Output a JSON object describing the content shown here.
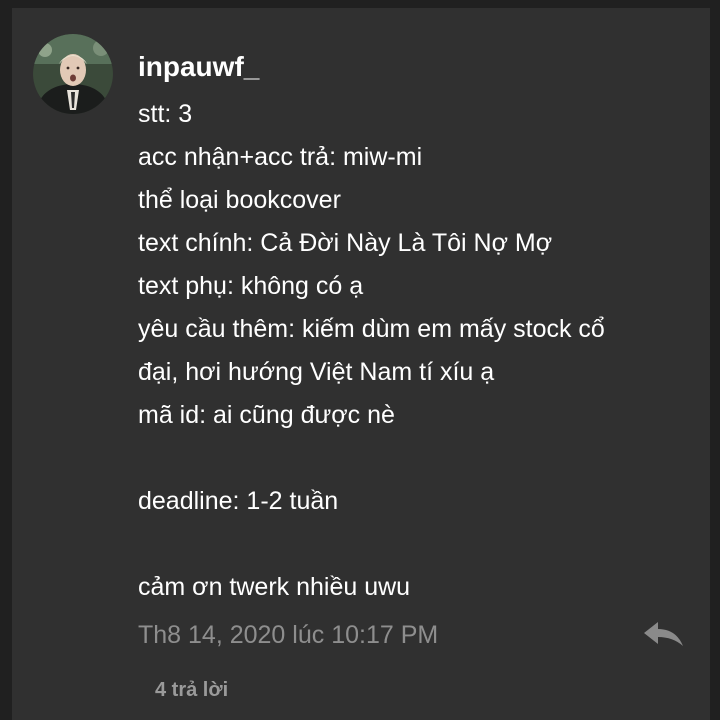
{
  "comment": {
    "username": "inpauwf_",
    "avatar_icon": "profile-photo",
    "lines": [
      "stt: 3",
      "acc nhận+acc trả: miw-mi",
      "thể loại bookcover",
      "text chính: Cả Đời Này Là Tôi Nợ Mợ",
      "text phụ: không có ạ",
      "yêu cầu thêm: kiếm dùm em mấy stock cổ",
      "đại, hơi hướng Việt Nam tí xíu ạ",
      "mã id: ai cũng được nè",
      "",
      "deadline: 1-2 tuần",
      "",
      "cảm ơn twerk nhiều uwu"
    ],
    "timestamp": "Th8 14, 2020 lúc 10:17 PM",
    "reply_icon": "reply-arrow-icon",
    "replies_count_label": "4 trả lời"
  },
  "colors": {
    "background": "#202020",
    "card": "#303030",
    "text": "#ffffff",
    "muted_text": "#8e8e8e",
    "reply_icon": "#8a8a8a"
  }
}
